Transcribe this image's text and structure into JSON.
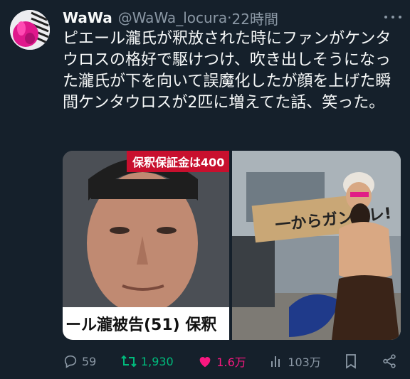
{
  "tweet": {
    "author_name": "WaWa",
    "handle": "@WaWa_locura",
    "separator": "·",
    "time": "22時間",
    "text": "ピエール瀧氏が釈放された時にファンがケンタウロスの格好で駆けつけ、吹き出しそうになった瀧氏が下を向いて誤魔化したが顔を上げた瞬間ケンタウロスが2匹に増えてた話、笑った。"
  },
  "media": {
    "left": {
      "banner": "保釈保証金は400",
      "caption": "ール瀧被告(51) 保釈"
    },
    "right": {
      "sign_text": "一からガンバレ!"
    }
  },
  "actions": {
    "replies": "59",
    "reposts": "1,930",
    "likes": "1.6万",
    "views": "103万"
  },
  "colors": {
    "background": "#15202b",
    "text": "#f7f9f9",
    "muted": "#8b98a5",
    "repost_active": "#00ba7c",
    "like_active": "#f91880"
  }
}
